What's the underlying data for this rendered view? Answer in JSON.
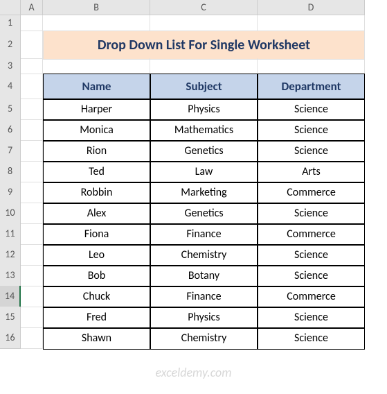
{
  "columns": [
    "A",
    "B",
    "C",
    "D"
  ],
  "row_numbers": [
    1,
    2,
    3,
    4,
    5,
    6,
    7,
    8,
    9,
    10,
    11,
    12,
    13,
    14,
    15,
    16
  ],
  "selected_row": 14,
  "title": "Drop Down List For Single Worksheet",
  "headers": {
    "name": "Name",
    "subject": "Subject",
    "department": "Department"
  },
  "rows": [
    {
      "name": "Harper",
      "subject": "Physics",
      "department": "Science"
    },
    {
      "name": "Monica",
      "subject": "Mathematics",
      "department": "Science"
    },
    {
      "name": "Rion",
      "subject": "Genetics",
      "department": "Science"
    },
    {
      "name": "Ted",
      "subject": "Law",
      "department": "Arts"
    },
    {
      "name": "Robbin",
      "subject": "Marketing",
      "department": "Commerce"
    },
    {
      "name": "Alex",
      "subject": "Genetics",
      "department": "Science"
    },
    {
      "name": "Fiona",
      "subject": "Finance",
      "department": "Commerce"
    },
    {
      "name": "Leo",
      "subject": "Chemistry",
      "department": "Science"
    },
    {
      "name": "Bob",
      "subject": "Botany",
      "department": "Science"
    },
    {
      "name": "Chuck",
      "subject": "Finance",
      "department": "Commerce"
    },
    {
      "name": "Fred",
      "subject": "Physics",
      "department": "Science"
    },
    {
      "name": "Shawn",
      "subject": "Chemistry",
      "department": "Science"
    }
  ],
  "watermark": "exceldemy.com"
}
